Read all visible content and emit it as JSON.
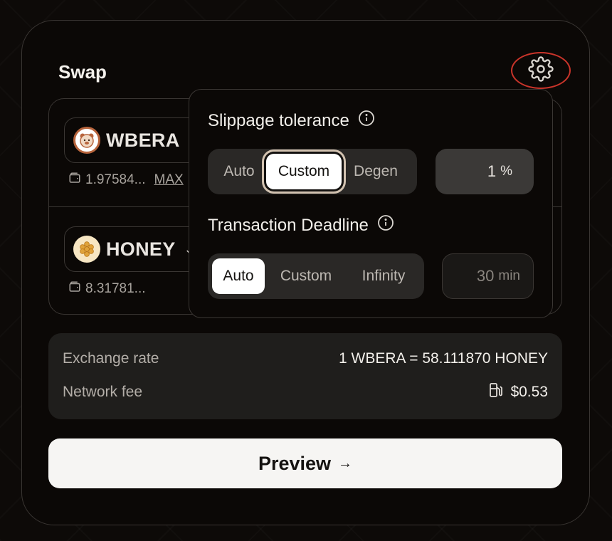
{
  "header": {
    "title": "Swap"
  },
  "colors": {
    "accent_ring": "#c9342a",
    "honey": "#e0a33c",
    "bear": "#b7643c"
  },
  "tokens": [
    {
      "symbol": "WBERA",
      "balance": "1.97584...",
      "max_label": "MAX",
      "icon": "bear-icon"
    },
    {
      "symbol": "HONEY",
      "balance": "8.31781...",
      "icon": "honeycomb-icon"
    }
  ],
  "settings": {
    "slippage": {
      "label": "Slippage tolerance",
      "options": [
        "Auto",
        "Custom",
        "Degen"
      ],
      "selected": "Custom",
      "value": "1",
      "unit": "%"
    },
    "deadline": {
      "label": "Transaction Deadline",
      "options": [
        "Auto",
        "Custom",
        "Infinity"
      ],
      "selected": "Auto",
      "value": "30",
      "unit": "min"
    }
  },
  "info": {
    "exchange_rate_label": "Exchange rate",
    "exchange_rate_value": "1 WBERA = 58.111870 HONEY",
    "network_fee_label": "Network fee",
    "network_fee_value": "$0.53"
  },
  "preview": {
    "label": "Preview",
    "arrow": "→"
  }
}
